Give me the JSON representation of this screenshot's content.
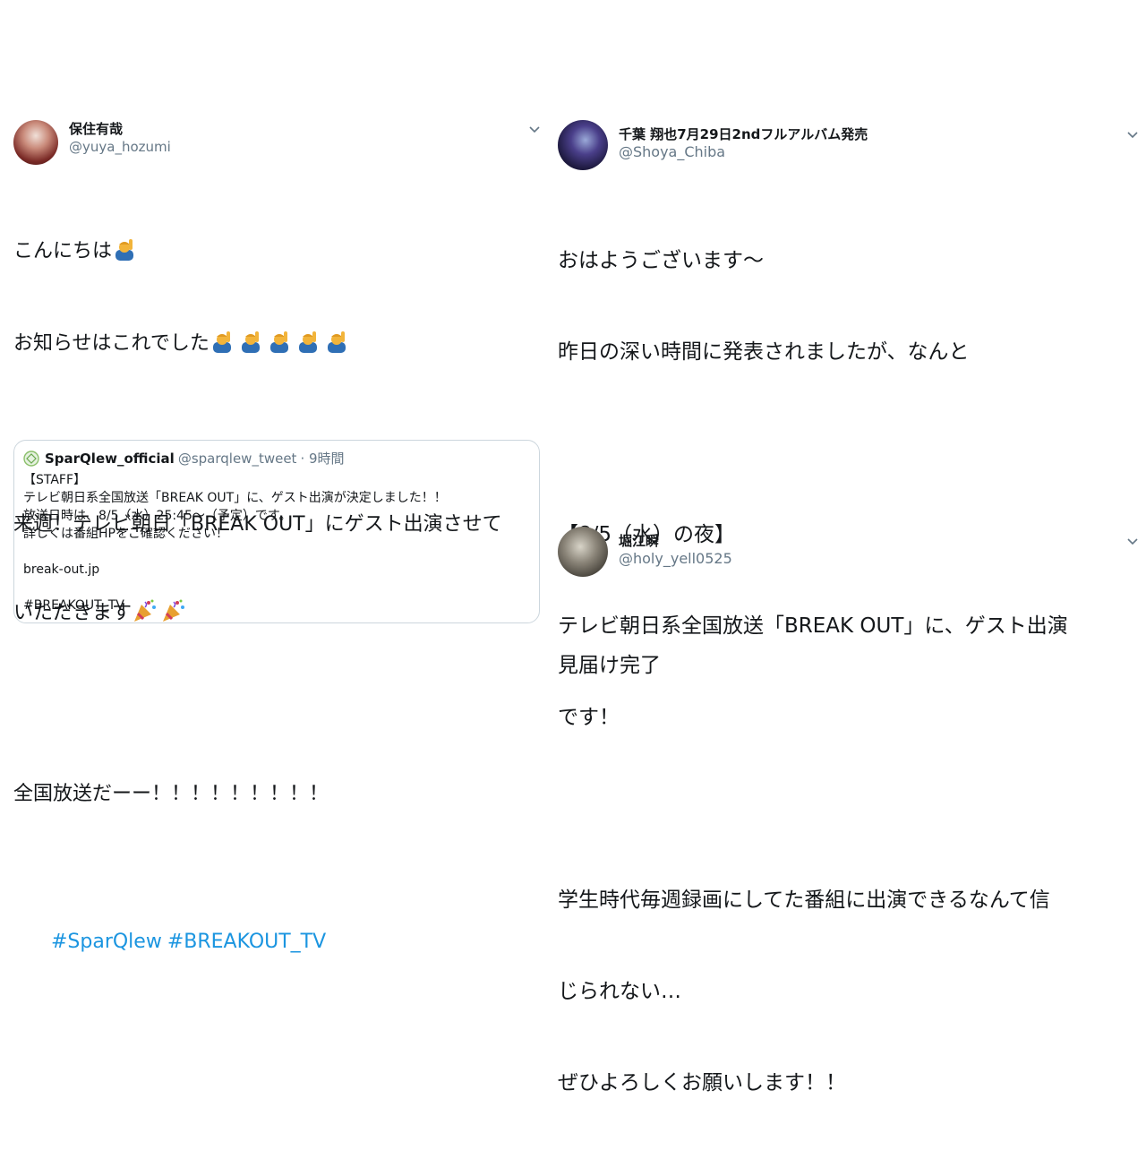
{
  "tweets": {
    "left": {
      "display_name": "保住有哉",
      "handle": "@yuya_hozumi",
      "lines": [
        "こんにちは",
        "お知らせはこれでした",
        "",
        "来週！テレビ朝日「BREAK OUT」にゲスト出演させて",
        "いただきます",
        "",
        "全国放送だーー！！！！！！！！！"
      ],
      "hashtags": [
        "#SparQlew",
        "#BREAKOUT_TV"
      ],
      "quote": {
        "name": "SparQlew_official",
        "handle": "@sparqlew_tweet",
        "time": "· 9時間",
        "lines": [
          "【STAFF】",
          "テレビ朝日系全国放送「BREAK OUT」に、ゲスト出演が決定しました！！",
          "放送日時は、8/5（水）25:45～（予定）です。",
          "詳しくは番組HPをご確認ください！",
          "",
          "break-out.jp",
          "",
          "#BREAKOUT_TV"
        ]
      }
    },
    "right_top": {
      "display_name": "千葉 翔也7月29日2ndフルアルバム発売",
      "handle": "@Shoya_Chiba",
      "lines": [
        "おはようございます〜",
        "昨日の深い時間に発表されましたが、なんと",
        "",
        "【8/5（水）の夜】",
        "テレビ朝日系全国放送「BREAK OUT」に、ゲスト出演",
        "です！",
        "",
        "学生時代毎週録画にしてた番組に出演できるなんて信",
        "じられない…",
        "ぜひよろしくお願いします！！"
      ]
    },
    "right_bottom": {
      "display_name": "堀江瞬",
      "handle": "@holy_yell0525",
      "lines": [
        "見届け完了"
      ]
    }
  },
  "icons": {
    "emoji_person": "person-raising-hand-icon",
    "emoji_party": "party-popper-icon",
    "caret": "chevron-down-icon",
    "quote_logo": "sparqlew-logo-icon"
  },
  "colors": {
    "text": "#14171a",
    "muted": "#657786",
    "link": "#1b95e0",
    "border": "#ccd6dd"
  }
}
